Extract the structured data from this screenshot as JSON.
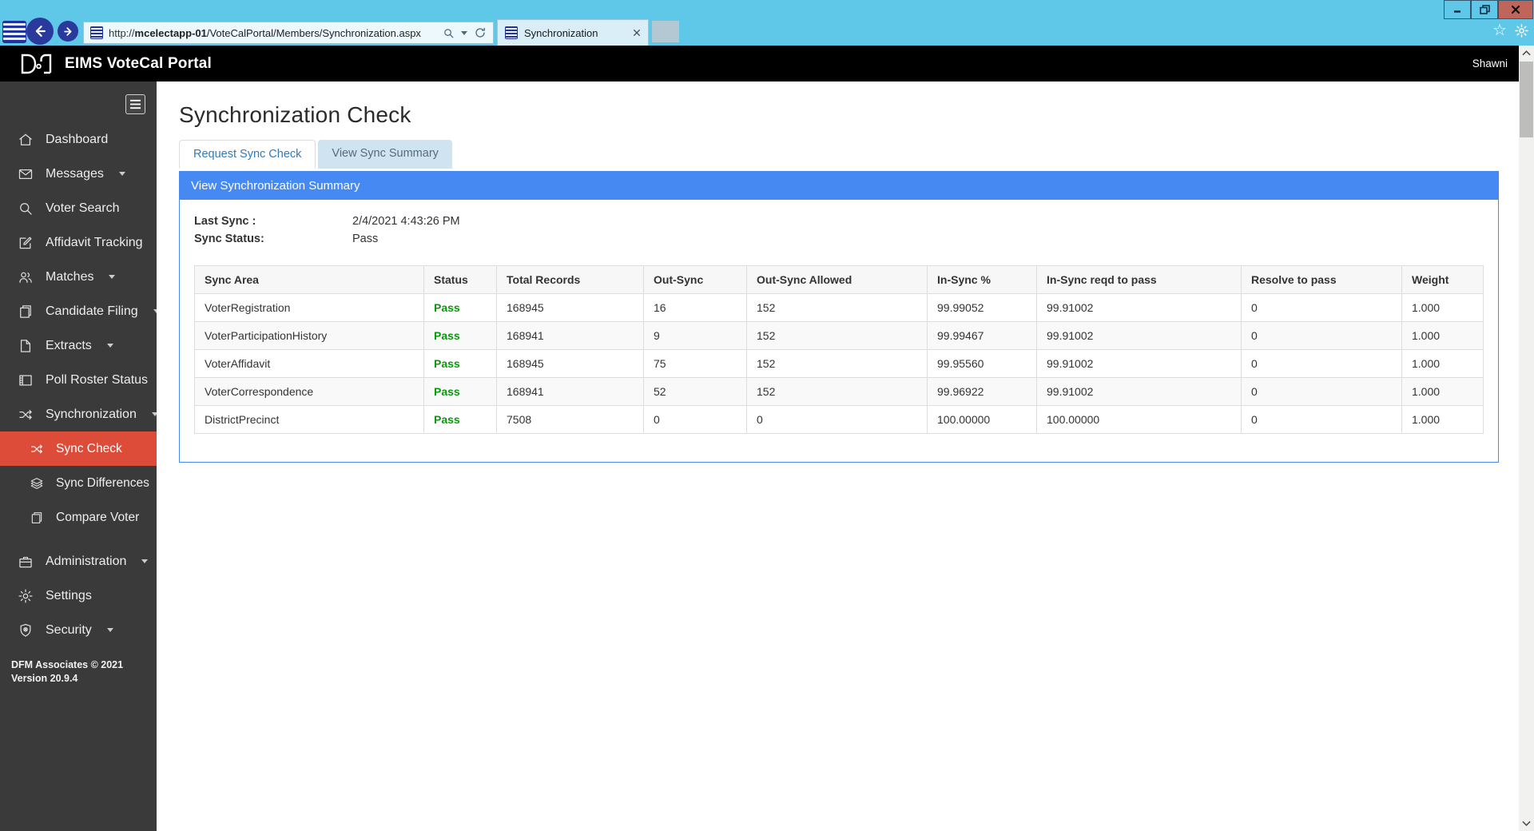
{
  "browser": {
    "url": {
      "prefix": "http://",
      "host": "mcelectapp-01",
      "path": "/VoteCalPortal/Members/Synchronization.aspx"
    },
    "tab_title": "Synchronization",
    "icons": {
      "favorites_star": "☆"
    }
  },
  "header": {
    "app_title": "EIMS VoteCal Portal",
    "user": "Shawni"
  },
  "sidebar": {
    "items": [
      {
        "label": "Dashboard",
        "icon": "home",
        "caret": false,
        "sub": false,
        "active": false
      },
      {
        "label": "Messages",
        "icon": "envelope",
        "caret": true,
        "sub": false,
        "active": false
      },
      {
        "label": "Voter Search",
        "icon": "search",
        "caret": false,
        "sub": false,
        "active": false
      },
      {
        "label": "Affidavit Tracking",
        "icon": "edit-square",
        "caret": false,
        "sub": false,
        "active": false
      },
      {
        "label": "Matches",
        "icon": "users",
        "caret": true,
        "sub": false,
        "active": false
      },
      {
        "label": "Candidate Filing",
        "icon": "copy-pages",
        "caret": true,
        "sub": false,
        "active": false
      },
      {
        "label": "Extracts",
        "icon": "file",
        "caret": true,
        "sub": false,
        "active": false
      },
      {
        "label": "Poll Roster Status",
        "icon": "roster",
        "caret": false,
        "sub": false,
        "active": false
      },
      {
        "label": "Synchronization",
        "icon": "shuffle",
        "caret": true,
        "sub": false,
        "active": false
      },
      {
        "label": "Sync Check",
        "icon": "shuffle",
        "caret": false,
        "sub": true,
        "active": true
      },
      {
        "label": "Sync Differences",
        "icon": "layers",
        "caret": false,
        "sub": true,
        "active": false
      },
      {
        "label": "Compare Voter",
        "icon": "copy-pages",
        "caret": false,
        "sub": true,
        "active": false
      },
      {
        "label": "Administration",
        "icon": "briefcase",
        "caret": true,
        "sub": false,
        "active": false
      },
      {
        "label": "Settings",
        "icon": "gear",
        "caret": false,
        "sub": false,
        "active": false
      },
      {
        "label": "Security",
        "icon": "shield",
        "caret": true,
        "sub": false,
        "active": false
      }
    ],
    "footer": {
      "line1": "DFM Associates © 2021",
      "line2": "Version 20.9.4"
    }
  },
  "main": {
    "page_title": "Synchronization Check",
    "tabs": [
      {
        "label": "Request Sync Check",
        "active": true
      },
      {
        "label": "View Sync Summary",
        "active": false
      }
    ],
    "panel": {
      "heading": "View Synchronization Summary",
      "last_sync_label": "Last Sync :",
      "last_sync_value": "2/4/2021 4:43:26 PM",
      "sync_status_label": "Sync Status:",
      "sync_status_value": "Pass",
      "table": {
        "columns": [
          "Sync Area",
          "Status",
          "Total Records",
          "Out-Sync",
          "Out-Sync Allowed",
          "In-Sync %",
          "In-Sync reqd to pass",
          "Resolve to pass",
          "Weight"
        ],
        "rows": [
          [
            "VoterRegistration",
            "Pass",
            "168945",
            "16",
            "152",
            "99.99052",
            "99.91002",
            "0",
            "1.000"
          ],
          [
            "VoterParticipationHistory",
            "Pass",
            "168941",
            "9",
            "152",
            "99.99467",
            "99.91002",
            "0",
            "1.000"
          ],
          [
            "VoterAffidavit",
            "Pass",
            "168945",
            "75",
            "152",
            "99.95560",
            "99.91002",
            "0",
            "1.000"
          ],
          [
            "VoterCorrespondence",
            "Pass",
            "168941",
            "52",
            "152",
            "99.96922",
            "99.91002",
            "0",
            "1.000"
          ],
          [
            "DistrictPrecinct",
            "Pass",
            "7508",
            "0",
            "0",
            "100.00000",
            "100.00000",
            "0",
            "1.000"
          ]
        ]
      }
    }
  },
  "colors": {
    "chrome": "#5fc8e9",
    "appbar": "#000000",
    "sidebar_bg": "#3a3a3a",
    "active_red": "#dd4b39",
    "heading_blue": "#4789f2",
    "link_blue": "#337ab7",
    "pass_green": "#0a990a",
    "tab_inactive_bg": "#cfe4f0"
  }
}
